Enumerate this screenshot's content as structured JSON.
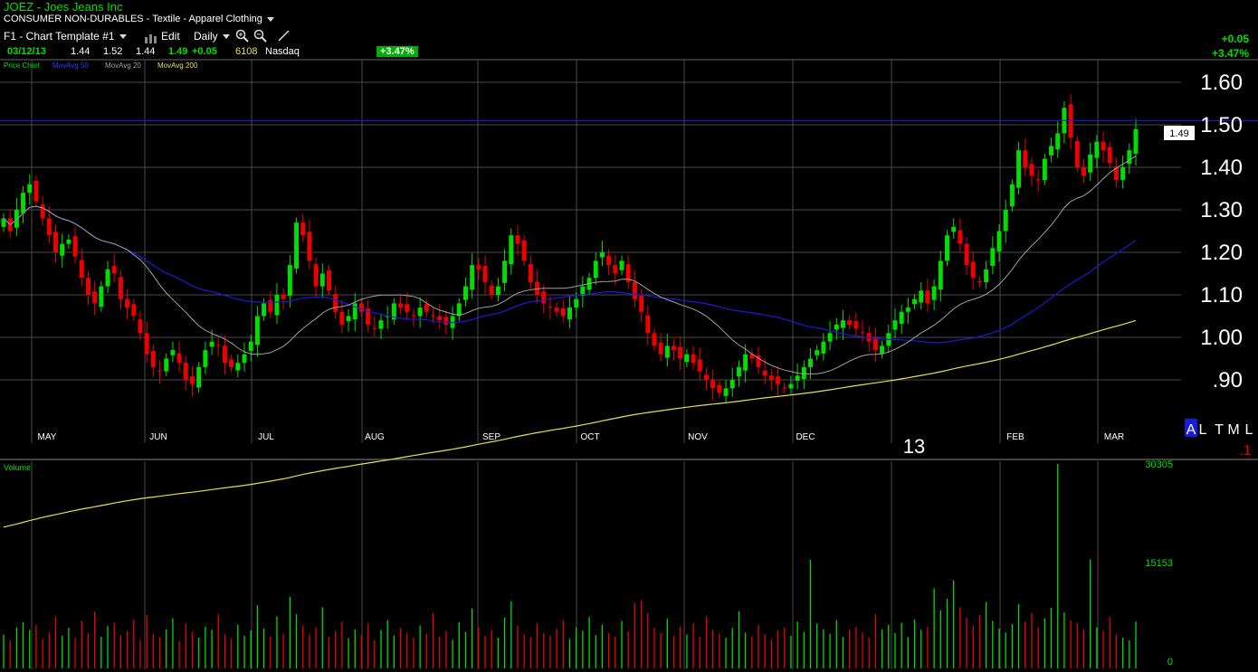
{
  "header": {
    "symbol_title": "JOEZ - Joes Jeans Inc",
    "sector_line": "CONSUMER NON-DURABLES - Textile - Apparel Clothing",
    "template": "F1 - Chart Template #1",
    "edit_label": "Edit",
    "period": "Daily",
    "quote": {
      "date": "03/12/13",
      "open": "1.44",
      "high": "1.52",
      "low": "1.44",
      "close": "1.49",
      "change": "+0.05",
      "volume": "6108",
      "exchange": "Nasdaq"
    },
    "change_badge": "+3.47%",
    "right_change": "+0.05",
    "right_pct": "+3.47%"
  },
  "legend": {
    "price_chart": "Price Chart",
    "ma50": "MovAvg 50",
    "ma20": "MovAvg 20",
    "ma200": "MovAvg 200"
  },
  "price_axis_labels": [
    "1.60",
    "1.50",
    "1.40",
    "1.30",
    "1.20",
    "1.10",
    "1.00",
    ".90"
  ],
  "last_price_tag": "1.49",
  "year_label": "13",
  "corner": {
    "a": "A",
    "l": "L",
    "t": "T",
    "m": "M",
    "l2": "L",
    "neg": ".1"
  },
  "volume": {
    "label": "Volume",
    "axis": [
      "30305",
      "15153",
      "0"
    ]
  },
  "colors": {
    "up": "#00dd00",
    "down": "#ee0000",
    "ma50": "#1a1adc",
    "ma20": "#a0a0a0",
    "ma200": "#e8e050",
    "grid": "#4a4a4a"
  },
  "chart_data": {
    "type": "candlestick",
    "title": "JOEZ - Joes Jeans Inc",
    "x_ticks": [
      "MAY",
      "JUN",
      "JUL",
      "AUG",
      "SEP",
      "OCT",
      "NOV",
      "DEC",
      "FEB",
      "MAR"
    ],
    "ylim": [
      0.85,
      1.65
    ],
    "volume_ylim": [
      0,
      30305
    ],
    "closes": [
      1.28,
      1.25,
      1.3,
      1.34,
      1.36,
      1.32,
      1.28,
      1.24,
      1.2,
      1.22,
      1.23,
      1.19,
      1.14,
      1.1,
      1.08,
      1.12,
      1.16,
      1.15,
      1.09,
      1.07,
      1.05,
      1.01,
      0.96,
      0.93,
      0.92,
      0.95,
      0.97,
      0.94,
      0.9,
      0.89,
      0.93,
      0.97,
      0.99,
      0.98,
      0.94,
      0.93,
      0.94,
      0.96,
      0.99,
      1.05,
      1.08,
      1.06,
      1.1,
      1.09,
      1.17,
      1.27,
      1.24,
      1.18,
      1.12,
      1.15,
      1.11,
      1.06,
      1.03,
      1.05,
      1.08,
      1.06,
      1.03,
      1.02,
      1.04,
      1.05,
      1.08,
      1.07,
      1.06,
      1.05,
      1.07,
      1.06,
      1.05,
      1.04,
      1.03,
      1.05,
      1.08,
      1.12,
      1.17,
      1.16,
      1.13,
      1.1,
      1.12,
      1.18,
      1.24,
      1.22,
      1.18,
      1.13,
      1.1,
      1.08,
      1.07,
      1.06,
      1.05,
      1.07,
      1.09,
      1.12,
      1.14,
      1.18,
      1.2,
      1.17,
      1.15,
      1.18,
      1.13,
      1.09,
      1.06,
      1.01,
      0.98,
      0.96,
      0.98,
      0.97,
      0.95,
      0.96,
      0.94,
      0.92,
      0.9,
      0.88,
      0.87,
      0.88,
      0.9,
      0.93,
      0.96,
      0.95,
      0.93,
      0.91,
      0.9,
      0.89,
      0.88,
      0.89,
      0.91,
      0.93,
      0.95,
      0.97,
      0.99,
      1.01,
      1.03,
      1.04,
      1.03,
      1.02,
      1.01,
      0.99,
      0.97,
      0.98,
      1.01,
      1.04,
      1.06,
      1.07,
      1.09,
      1.11,
      1.08,
      1.12,
      1.18,
      1.24,
      1.26,
      1.22,
      1.17,
      1.14,
      1.13,
      1.16,
      1.21,
      1.25,
      1.3,
      1.36,
      1.44,
      1.4,
      1.38,
      1.37,
      1.42,
      1.45,
      1.48,
      1.54,
      1.47,
      1.4,
      1.38,
      1.43,
      1.46,
      1.44,
      1.41,
      1.37,
      1.4,
      1.44,
      1.49
    ],
    "volumes": [
      4100,
      3200,
      5200,
      6000,
      4800,
      5600,
      3400,
      4400,
      6800,
      3900,
      5100,
      3600,
      6200,
      4300,
      7600,
      3800,
      5400,
      5900,
      4000,
      4600,
      6400,
      3300,
      7100,
      4200,
      3700,
      4900,
      6600,
      3100,
      5800,
      4500,
      3600,
      5300,
      4800,
      7200,
      4100,
      3400,
      5600,
      3900,
      4700,
      8600,
      5000,
      3800,
      6900,
      4200,
      9900,
      7200,
      5500,
      4100,
      5200,
      8300,
      3700,
      4600,
      6100,
      3500,
      4900,
      4000,
      5700,
      3200,
      4800,
      6300,
      3900,
      5100,
      4400,
      3600,
      5500,
      4200,
      7400,
      3800,
      4700,
      3300,
      6000,
      4500,
      8100,
      5200,
      3900,
      4800,
      3600,
      6700,
      9200,
      5400,
      4100,
      3700,
      5800,
      4300,
      3900,
      4900,
      6300,
      3400,
      5200,
      4700,
      6800,
      4000,
      5600,
      4300,
      3800,
      6200,
      4600,
      8900,
      9400,
      7400,
      5100,
      4300,
      6500,
      3900,
      5300,
      4100,
      5800,
      3700,
      6900,
      4800,
      4200,
      3600,
      5100,
      7700,
      4400,
      3800,
      5600,
      4100,
      3300,
      4700,
      5200,
      3900,
      6100,
      4500,
      15600,
      5800,
      4900,
      4200,
      6300,
      3700,
      4800,
      5300,
      4400,
      3600,
      7200,
      4900,
      5600,
      4300,
      5900,
      3700,
      6400,
      4800,
      5300,
      11200,
      7800,
      9600,
      12400,
      8300,
      6700,
      5400,
      7100,
      9100,
      6200,
      5000,
      4400,
      5700,
      8800,
      6100,
      7400,
      5200,
      6600,
      8200,
      30300,
      7500,
      6300,
      5800,
      4900,
      15600,
      5200,
      4700,
      6800,
      4100,
      3600,
      3200,
      6100
    ]
  }
}
